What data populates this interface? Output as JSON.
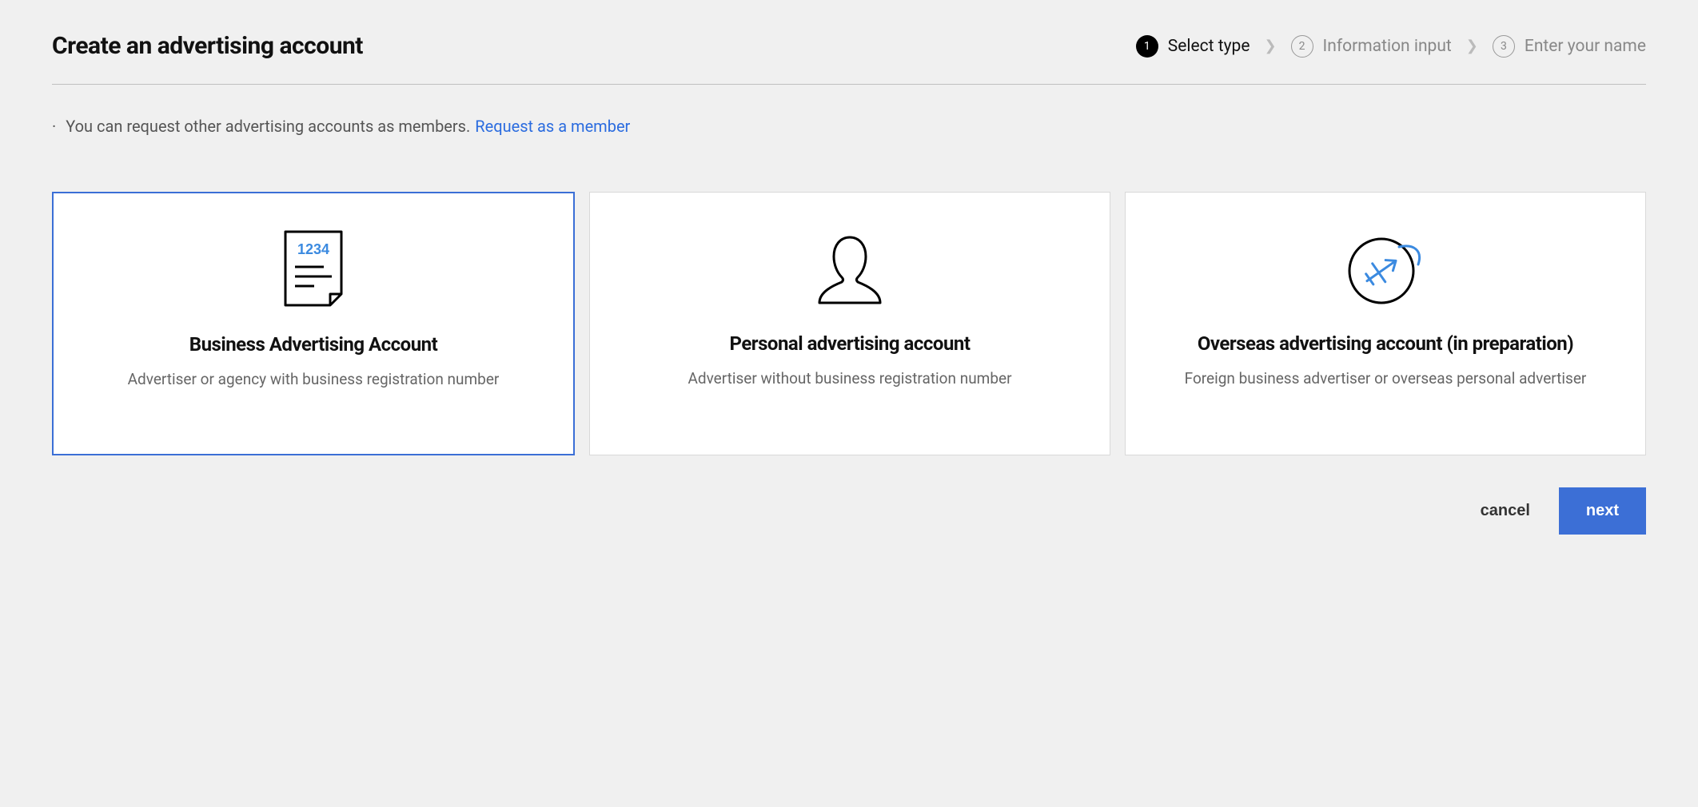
{
  "header": {
    "title": "Create an advertising account"
  },
  "stepper": {
    "steps": [
      {
        "num": "1",
        "label": "Select type",
        "active": true
      },
      {
        "num": "2",
        "label": "Information input",
        "active": false
      },
      {
        "num": "3",
        "label": "Enter your name",
        "active": false
      }
    ]
  },
  "info": {
    "text": "You can request other advertising accounts as members.",
    "link": "Request as a member"
  },
  "cards": [
    {
      "title": "Business Advertising Account",
      "desc": "Advertiser or agency with business registration number",
      "selected": true,
      "icon": "document-1234-icon"
    },
    {
      "title": "Personal advertising account",
      "desc": "Advertiser without business registration number",
      "selected": false,
      "icon": "person-silhouette-icon"
    },
    {
      "title": "Overseas advertising account (in preparation)",
      "desc": "Foreign business advertiser or overseas personal advertiser",
      "selected": false,
      "icon": "globe-plane-icon"
    }
  ],
  "footer": {
    "cancel": "cancel",
    "next": "next"
  }
}
